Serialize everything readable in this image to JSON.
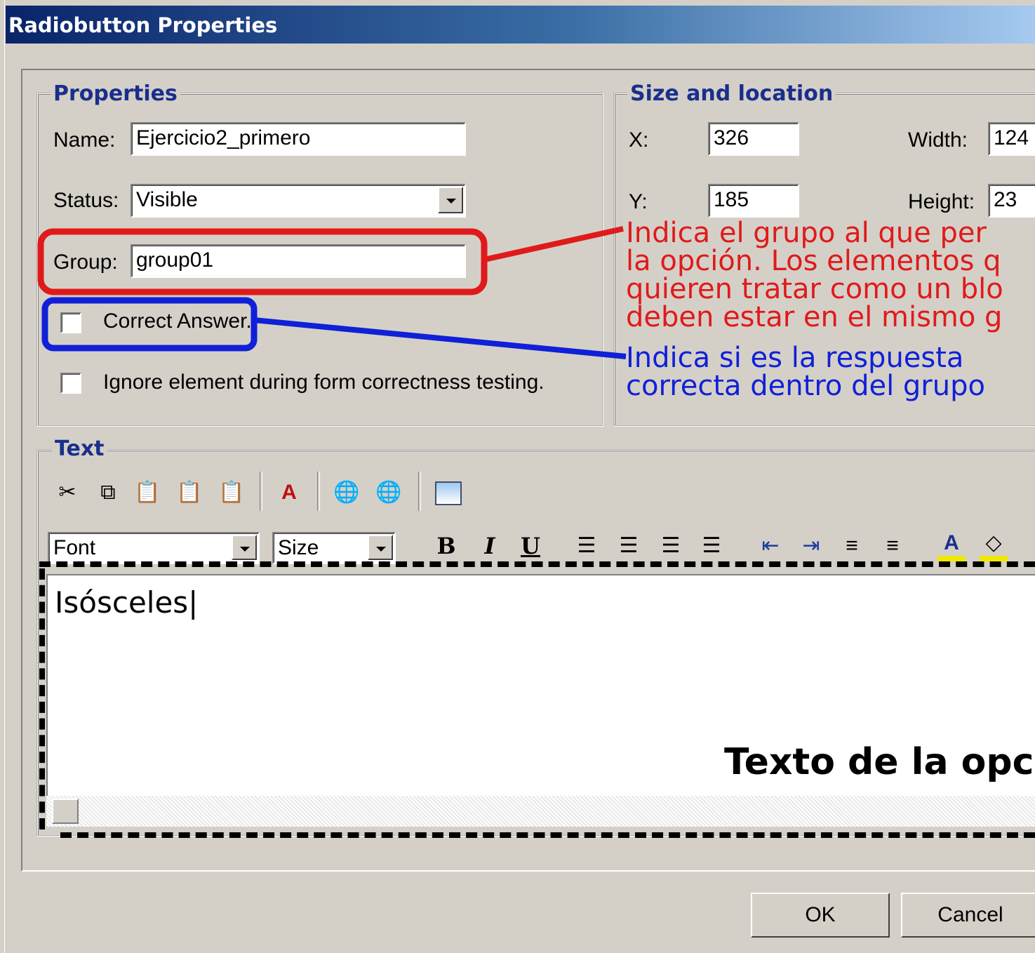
{
  "window": {
    "title": "Radiobutton Properties"
  },
  "properties": {
    "legend": "Properties",
    "name_label": "Name:",
    "name_value": "Ejercicio2_primero",
    "status_label": "Status:",
    "status_value": "Visible",
    "group_label": "Group:",
    "group_value": "group01",
    "correct_answer_label": "Correct Answer.",
    "correct_answer_checked": false,
    "ignore_label": "Ignore element during form correctness testing.",
    "ignore_checked": false
  },
  "size_location": {
    "legend": "Size and location",
    "x_label": "X:",
    "x_value": "326",
    "y_label": "Y:",
    "y_value": "185",
    "width_label": "Width:",
    "width_value": "124",
    "height_label": "Height:",
    "height_value": "23"
  },
  "annotations": {
    "group_note": [
      "Indica el grupo al que per",
      "la opción. Los elementos q",
      "quieren tratar como un blo",
      "deben estar en el mismo g"
    ],
    "correct_note": [
      "Indica si es la respuesta",
      "correcta dentro del grupo"
    ],
    "text_note": "Texto de la opc",
    "colors": {
      "red": "#e01a1a",
      "blue": "#1020d8"
    }
  },
  "text_section": {
    "legend": "Text",
    "toolbar_icons": [
      "cut-icon",
      "copy-icon",
      "paste-icon",
      "paste-text-icon",
      "paste-html-icon",
      "find-replace-icon",
      "link-icon",
      "unlink-icon",
      "image-icon"
    ],
    "font_placeholder": "Font",
    "size_placeholder": "Size",
    "bold": "B",
    "italic": "I",
    "underline": "U",
    "editor_content": "Isósceles"
  },
  "buttons": {
    "ok": "OK",
    "cancel": "Cancel"
  }
}
